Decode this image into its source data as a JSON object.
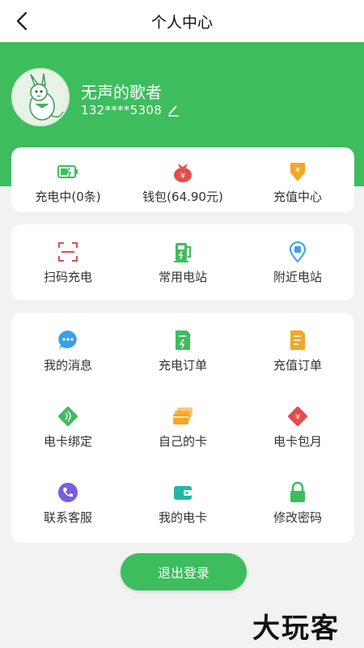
{
  "header": {
    "title": "个人中心"
  },
  "profile": {
    "name": "无声的歌者",
    "phone": "132****5308"
  },
  "top_card": [
    {
      "label": "充电中(0条)",
      "icon": "battery-charging-icon"
    },
    {
      "label": "钱包(64.90元)",
      "icon": "wallet-bag-icon"
    },
    {
      "label": "充值中心",
      "icon": "recharge-center-icon"
    }
  ],
  "quick_card": [
    {
      "label": "扫码充电",
      "icon": "scan-icon"
    },
    {
      "label": "常用电站",
      "icon": "charging-pile-icon"
    },
    {
      "label": "附近电站",
      "icon": "location-pin-icon"
    }
  ],
  "menu_card": [
    {
      "label": "我的消息",
      "icon": "message-icon"
    },
    {
      "label": "充电订单",
      "icon": "charge-order-icon"
    },
    {
      "label": "充值订单",
      "icon": "recharge-order-icon"
    },
    {
      "label": "电卡绑定",
      "icon": "card-bind-icon"
    },
    {
      "label": "自己的卡",
      "icon": "cards-icon"
    },
    {
      "label": "电卡包月",
      "icon": "monthly-card-icon"
    },
    {
      "label": "联系客服",
      "icon": "phone-icon"
    },
    {
      "label": "我的电卡",
      "icon": "wallet-card-icon"
    },
    {
      "label": "修改密码",
      "icon": "lock-icon"
    }
  ],
  "logout_label": "退出登录",
  "watermark": "大玩客",
  "colors": {
    "brand_green": "#3dbd5d",
    "red": "#e84b4b",
    "orange": "#f5a623",
    "blue": "#3aa0e8",
    "purple": "#7a5ce0"
  }
}
